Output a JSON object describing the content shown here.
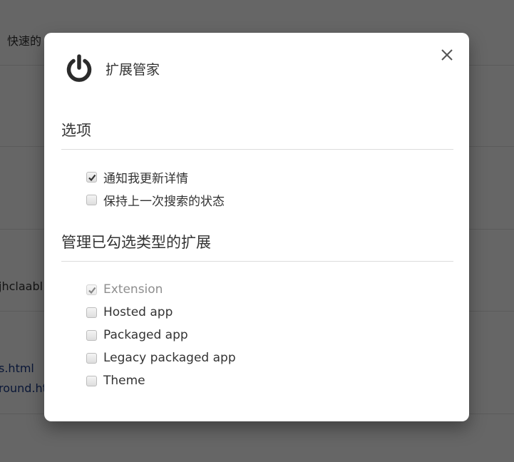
{
  "background": {
    "rows": [
      {
        "text": "快速的"
      },
      {
        "text": "jhclaabl"
      },
      {
        "text": "s.html",
        "link": true
      },
      {
        "text": "round.ht",
        "link": true
      }
    ]
  },
  "dialog": {
    "title": "扩展管家",
    "icon": "power-icon",
    "close_icon": "close-icon",
    "options_section": {
      "title": "选项",
      "items": [
        {
          "label": "通知我更新详情",
          "checked": true,
          "disabled": false
        },
        {
          "label": "保持上一次搜索的状态",
          "checked": false,
          "disabled": false
        }
      ]
    },
    "types_section": {
      "title": "管理已勾选类型的扩展",
      "items": [
        {
          "label": "Extension",
          "checked": true,
          "disabled": true
        },
        {
          "label": "Hosted app",
          "checked": false,
          "disabled": false
        },
        {
          "label": "Packaged app",
          "checked": false,
          "disabled": false
        },
        {
          "label": "Legacy packaged app",
          "checked": false,
          "disabled": false
        },
        {
          "label": "Theme",
          "checked": false,
          "disabled": false
        }
      ]
    }
  }
}
